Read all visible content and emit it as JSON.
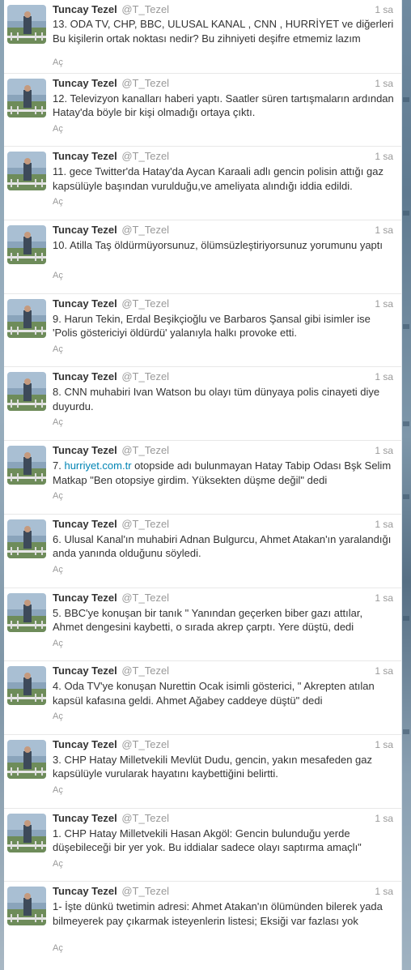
{
  "tweets": [
    {
      "name": "Tuncay Tezel",
      "screen_name": "@T_Tezel",
      "time": "1 sa",
      "text": "13. ODA TV, CHP, BBC, ULUSAL KANAL , CNN , HURRİYET ve diğerleri Bu kişilerin ortak noktası nedir? Bu zihniyeti deşifre etmemiz lazım",
      "expand": "Aç"
    },
    {
      "name": "Tuncay Tezel",
      "screen_name": "@T_Tezel",
      "time": "1 sa",
      "text": "12. Televizyon kanalları haberi yaptı. Saatler süren tartışmaların ardından Hatay'da böyle bir kişi olmadığı ortaya çıktı.",
      "expand": "Aç"
    },
    {
      "name": "Tuncay Tezel",
      "screen_name": "@T_Tezel",
      "time": "1 sa",
      "text": "11. gece Twitter'da Hatay'da Aycan Karaali adlı gencin polisin attığı gaz kapsülüyle başından vurulduğu,ve ameliyata alındığı iddia edildi.",
      "expand": "Aç"
    },
    {
      "name": "Tuncay Tezel",
      "screen_name": "@T_Tezel",
      "time": "1 sa",
      "text": "10. Atilla Taş öldürmüyorsunuz, ölümsüzleştiriyorsunuz yorumunu yaptı",
      "expand": "Aç"
    },
    {
      "name": "Tuncay Tezel",
      "screen_name": "@T_Tezel",
      "time": "1 sa",
      "text": "9. Harun Tekin, Erdal Beşikçioğlu ve Barbaros Şansal gibi isimler ise 'Polis göstericiyi öldürdü' yalanıyla halkı provoke etti.",
      "expand": "Aç"
    },
    {
      "name": "Tuncay Tezel",
      "screen_name": "@T_Tezel",
      "time": "1 sa",
      "text": "8. CNN muhabiri Ivan Watson bu olayı tüm dünyaya polis cinayeti diye duyurdu.",
      "expand": "Aç"
    },
    {
      "name": "Tuncay Tezel",
      "screen_name": "@T_Tezel",
      "time": "1 sa",
      "text_prefix": "7. ",
      "link": "hurriyet.com.tr",
      "text": " otopside adı bulunmayan Hatay Tabip Odası Bşk Selim Matkap \"Ben  otopsiye girdim. Yüksekten düşme değil\" dedi",
      "expand": "Aç"
    },
    {
      "name": "Tuncay Tezel",
      "screen_name": "@T_Tezel",
      "time": "1 sa",
      "text": "6. Ulusal Kanal'ın muhabiri Adnan Bulgurcu, Ahmet Atakan'ın yaralandığı anda yanında olduğunu söyledi.",
      "expand": "Aç"
    },
    {
      "name": "Tuncay Tezel",
      "screen_name": "@T_Tezel",
      "time": "1 sa",
      "text": "5. BBC'ye konuşan bir tanık \" Yanından geçerken biber gazı attılar, Ahmet dengesini kaybetti, o sırada akrep çarptı. Yere düştü, dedi",
      "expand": "Aç"
    },
    {
      "name": "Tuncay Tezel",
      "screen_name": "@T_Tezel",
      "time": "1 sa",
      "text": "4. Oda TV'ye konuşan Nurettin Ocak isimli gösterici, \" Akrepten atılan kapsül kafasına geldi. Ahmet Ağabey caddeye düştü\" dedi",
      "expand": "Aç"
    },
    {
      "name": "Tuncay Tezel",
      "screen_name": "@T_Tezel",
      "time": "1 sa",
      "text": "3. CHP Hatay Milletvekili Mevlüt Dudu, gencin, yakın mesafeden gaz kapsülüyle vurularak hayatını kaybettiğini belirtti.",
      "expand": "Aç"
    },
    {
      "name": "Tuncay Tezel",
      "screen_name": "@T_Tezel",
      "time": "1 sa",
      "text": "1. CHP Hatay Milletvekili Hasan Akgöl: Gencin bulunduğu yerde düşebileceği bir yer yok. Bu iddialar sadece olayı saptırma amaçlı\"",
      "expand": "Aç"
    },
    {
      "name": "Tuncay Tezel",
      "screen_name": "@T_Tezel",
      "time": "1 sa",
      "text": "1- İşte dünkü twetimin adresi: Ahmet Atakan'ın ölümünden bilerek yada bilmeyerek pay çıkarmak isteyenlerin listesi; Eksiği var fazlası yok",
      "expand": "Aç"
    }
  ]
}
